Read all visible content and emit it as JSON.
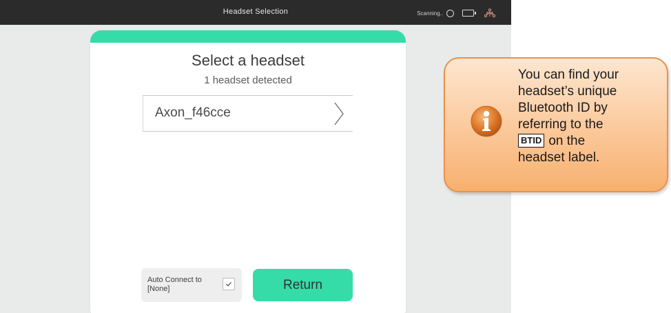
{
  "titlebar": {
    "title": "Headset Selection",
    "status_text": "Scanning..",
    "icons": [
      "scan-indicator-icon",
      "battery-icon",
      "network-icon"
    ]
  },
  "panel": {
    "title": "Select a headset",
    "subtitle": "1 headset detected",
    "headsets": [
      {
        "name": "Axon_f46cce"
      }
    ],
    "auto_connect_label": "Auto Connect to\n[None]",
    "auto_connect_checked": true,
    "return_label": "Return"
  },
  "callout": {
    "line1": "You can find your",
    "line2": "headset’s unique",
    "line3": "Bluetooth ID by",
    "line4": "referring to the",
    "badge": "BTID",
    "line5_rest": "on the",
    "line6": "headset label."
  },
  "colors": {
    "accent": "#36dca8",
    "titlebar": "#2b2b2b",
    "callout_border": "#e8914a",
    "info_icon": "#e07b2a"
  }
}
